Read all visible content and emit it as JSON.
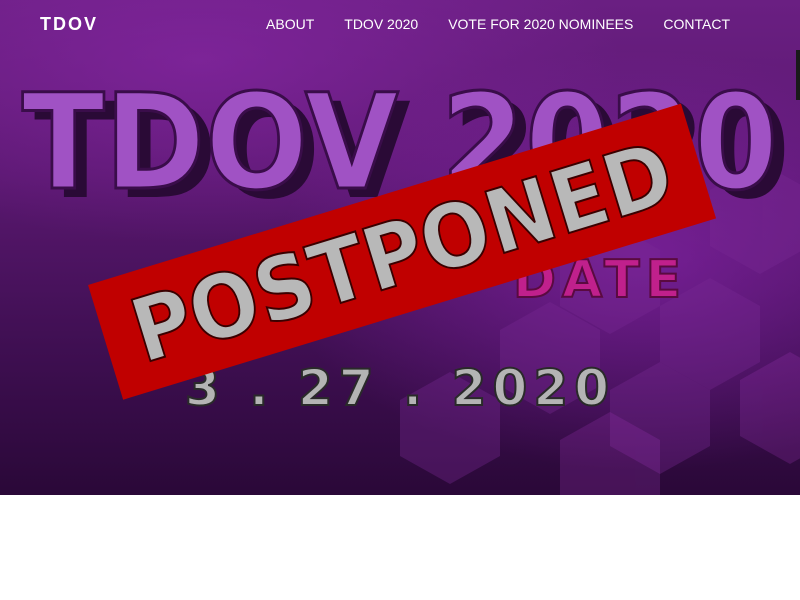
{
  "nav": {
    "brand": "TDOV",
    "links": [
      "ABOUT",
      "TDOV 2020",
      "VOTE FOR 2020 NOMINEES",
      "CONTACT"
    ]
  },
  "hero": {
    "headline": "TDOV 2020",
    "subheadline": "DATE",
    "date": "3 . 27 . 2020",
    "stamp": "POSTPONED",
    "colors": {
      "headline": "#a052c4",
      "headline_shadow": "#2a0a36",
      "subheadline": "#c0208c",
      "date": "#b4b4b4",
      "stamp_bg": "#c00000",
      "stamp_text": "#b8b8b8"
    }
  }
}
